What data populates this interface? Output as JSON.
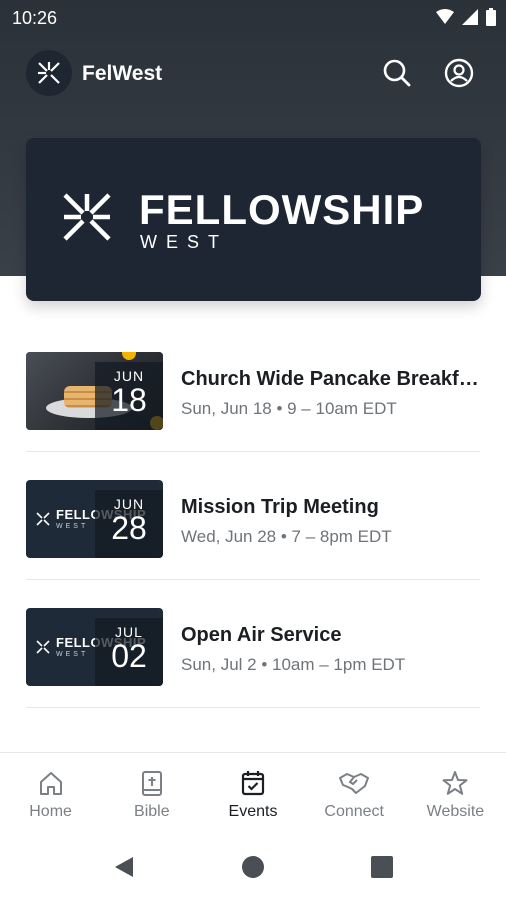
{
  "status_bar": {
    "time": "10:26",
    "icons": [
      "wifi-icon",
      "signal-icon",
      "battery-icon"
    ]
  },
  "app_bar": {
    "title": "FelWest",
    "actions": [
      "search-icon",
      "account-icon"
    ]
  },
  "hero": {
    "title": "FELLOWSHIP",
    "subtitle": "WEST"
  },
  "events": [
    {
      "title": "Church Wide Pancake Breakfast",
      "time": "Sun, Jun 18 • 9 – 10am EDT",
      "month": "JUN",
      "day": "18",
      "thumb": "pancake"
    },
    {
      "title": "Mission Trip Meeting",
      "time": "Wed, Jun 28 • 7 – 8pm EDT",
      "month": "JUN",
      "day": "28",
      "thumb": "fellowship"
    },
    {
      "title": "Open Air Service",
      "time": "Sun, Jul 2 • 10am – 1pm EDT",
      "month": "JUL",
      "day": "02",
      "thumb": "fellowship"
    }
  ],
  "thumb_logo": {
    "word": "FELLOWSHIP",
    "sub": "WEST"
  },
  "bottom_nav": [
    {
      "label": "Home",
      "icon": "home-icon"
    },
    {
      "label": "Bible",
      "icon": "bible-icon"
    },
    {
      "label": "Events",
      "icon": "events-icon",
      "active": true
    },
    {
      "label": "Connect",
      "icon": "connect-icon"
    },
    {
      "label": "Website",
      "icon": "star-icon"
    }
  ],
  "colors": {
    "header": "#2b3139",
    "hero": "#1d2632",
    "text": "#1b1f24",
    "muted": "#6f7479"
  }
}
